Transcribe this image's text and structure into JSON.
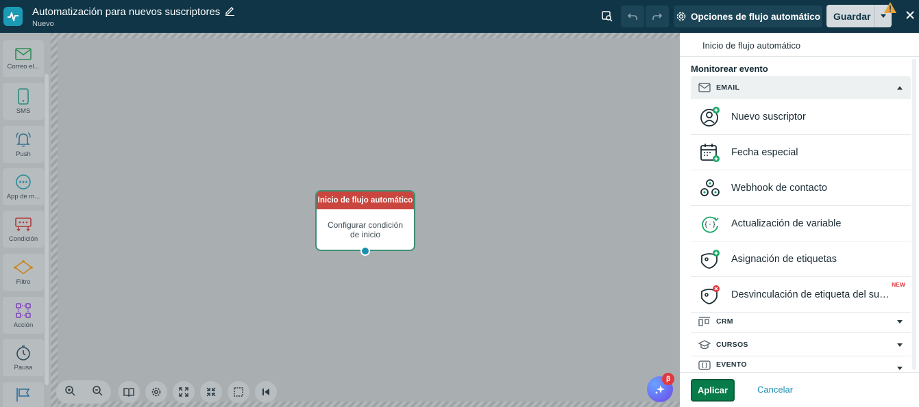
{
  "header": {
    "title": "Automatización para nuevos suscriptores",
    "status": "Nuevo",
    "options_label": "Opciones de flujo automático",
    "save_label": "Guardar"
  },
  "palette": {
    "items": [
      {
        "label": "Correo el...",
        "icon": "envelope-icon",
        "color": "#2e8b57"
      },
      {
        "label": "SMS",
        "icon": "phone-icon",
        "color": "#2a8a80"
      },
      {
        "label": "Push",
        "icon": "bell-icon",
        "color": "#3a6e88"
      },
      {
        "label": "App de m...",
        "icon": "chat-bubble-icon",
        "color": "#2a8a9a"
      },
      {
        "label": "Condición",
        "icon": "condition-icon",
        "color": "#b03a36"
      },
      {
        "label": "Filtro",
        "icon": "filter-icon",
        "color": "#c8861e"
      },
      {
        "label": "Acción",
        "icon": "action-icon",
        "color": "#7b3fb5"
      },
      {
        "label": "Pausa",
        "icon": "clock-icon",
        "color": "#2d4b5a"
      },
      {
        "label": "",
        "icon": "flag-icon",
        "color": "#2a6e9a"
      }
    ]
  },
  "canvas": {
    "node_title": "Inicio de flujo automático",
    "node_body": "Configurar condición de inicio",
    "ai_badge": "β"
  },
  "panel": {
    "header": "Inicio de flujo automático",
    "label": "Monitorear evento",
    "sections": {
      "email": "EMAIL",
      "crm": "CRM",
      "cursos": "CURSOS",
      "evento": "EVENTO"
    },
    "events": [
      {
        "label": "Nuevo suscriptor",
        "icon": "new-subscriber-icon"
      },
      {
        "label": "Fecha especial",
        "icon": "calendar-icon"
      },
      {
        "label": "Webhook de contacto",
        "icon": "webhook-icon"
      },
      {
        "label": "Actualización de variable",
        "icon": "variable-icon"
      },
      {
        "label": "Asignación de etiquetas",
        "icon": "tag-add-icon"
      },
      {
        "label": "Desvinculación de etiqueta del suscriptor",
        "icon": "tag-remove-icon",
        "badge": "NEW"
      }
    ],
    "apply_label": "Aplicar",
    "cancel_label": "Cancelar"
  },
  "colors": {
    "topbar": "#0f3546",
    "accent": "#1c9ab5",
    "node_header": "#c9453e",
    "apply": "#087b4a",
    "green_plus": "#1aa866",
    "red_x": "#e0393e"
  }
}
